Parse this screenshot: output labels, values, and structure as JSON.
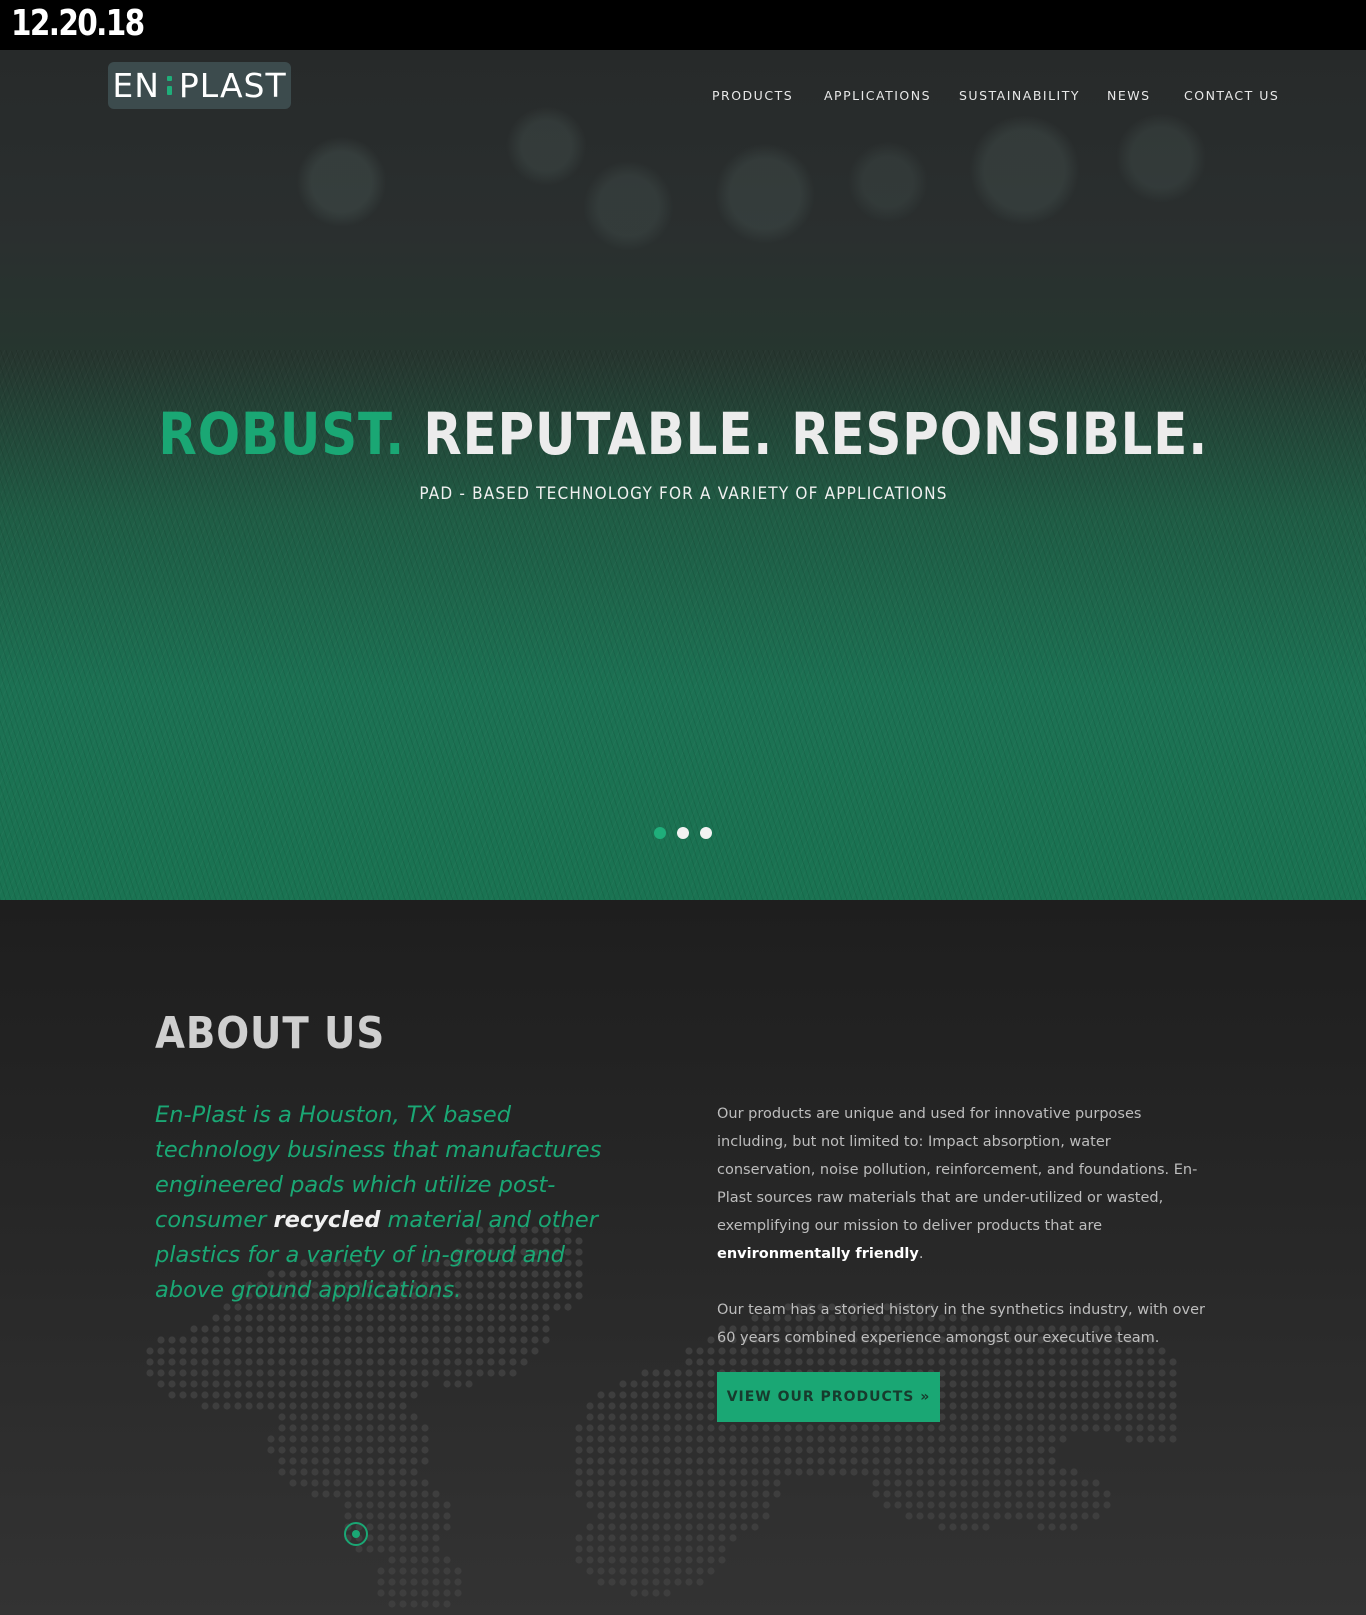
{
  "date_label": "12.20.18",
  "brand": {
    "left": "EN",
    "right": "PLAST",
    "accent_color": "#1fae7a",
    "logo_bg": "#3c4b4d"
  },
  "nav": {
    "items": [
      {
        "label": "PRODUCTS"
      },
      {
        "label": "APPLICATIONS"
      },
      {
        "label": "SUSTAINABILITY"
      },
      {
        "label": "NEWS"
      },
      {
        "label": "CONTACT US"
      }
    ]
  },
  "hero": {
    "headline_accent": "ROBUST.",
    "headline_rest": " REPUTABLE. RESPONSIBLE.",
    "subheadline": "PAD - BASED TECHNOLOGY FOR A VARIETY OF APPLICATIONS",
    "slides_total": 3,
    "active_slide": 1
  },
  "about": {
    "title": "ABOUT US",
    "lead_before": "En-Plast is a Houston, TX based technology business that manufactures engineered pads which utilize post-consumer ",
    "lead_highlight": "recycled",
    "lead_after": " material and other plastics for a variety of in-groud and above ground applications.",
    "body1_before": "Our products are unique and used for innovative purposes including, but not limited to: Impact absorption, water conservation, noise pollution, reinforcement, and foundations. En-Plast sources raw materials that are under-utilized or wasted, exemplifying our mission to deliver products that are ",
    "body1_highlight": "environmentally friendly",
    "body1_after": ".",
    "body2": "Our team has a storied history in the synthetics industry, with over 60 years combined experience amongst our executive team.",
    "cta_label": "VIEW OUR PRODUCTS »"
  },
  "colors": {
    "accent": "#1aa774",
    "background_dark": "#1f1f1f"
  }
}
